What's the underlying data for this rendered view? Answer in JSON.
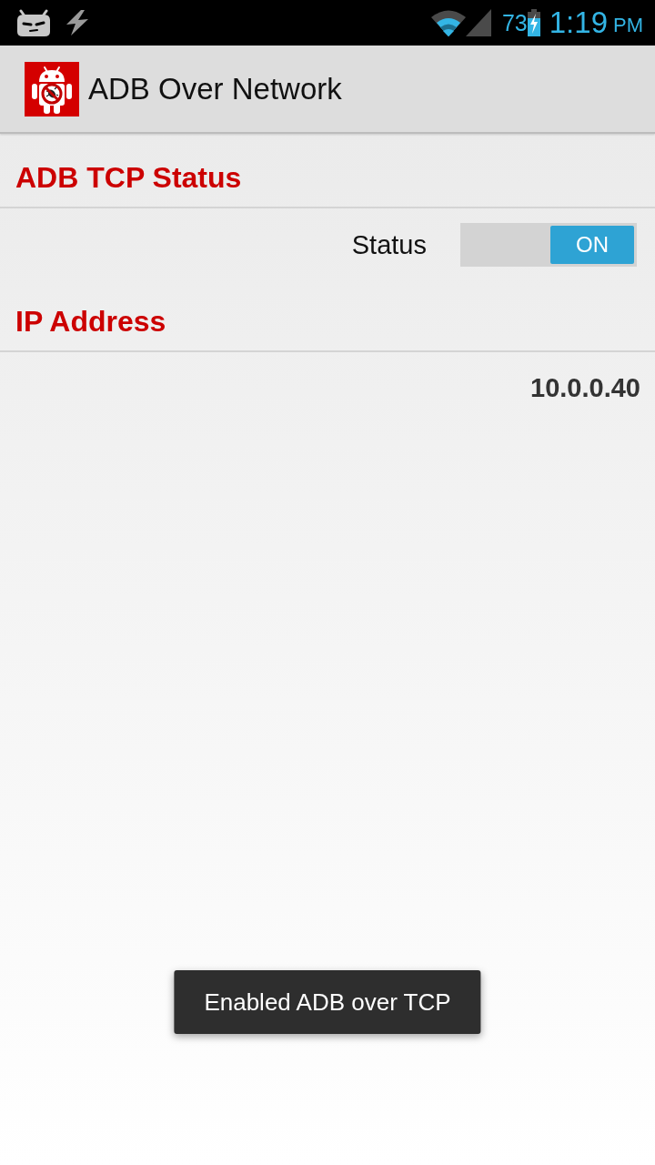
{
  "status_bar": {
    "battery": "73",
    "time": "1:19",
    "am_pm": "PM"
  },
  "action_bar": {
    "title": "ADB Over Network"
  },
  "sections": [
    {
      "header": "ADB TCP Status",
      "rows": [
        {
          "kind": "switch",
          "label": "Status",
          "on": true,
          "switch_text": "ON"
        }
      ]
    },
    {
      "header": "IP Address",
      "rows": [
        {
          "kind": "value",
          "value": "10.0.0.40"
        }
      ]
    }
  ],
  "toast": {
    "message": "Enabled ADB over TCP"
  }
}
